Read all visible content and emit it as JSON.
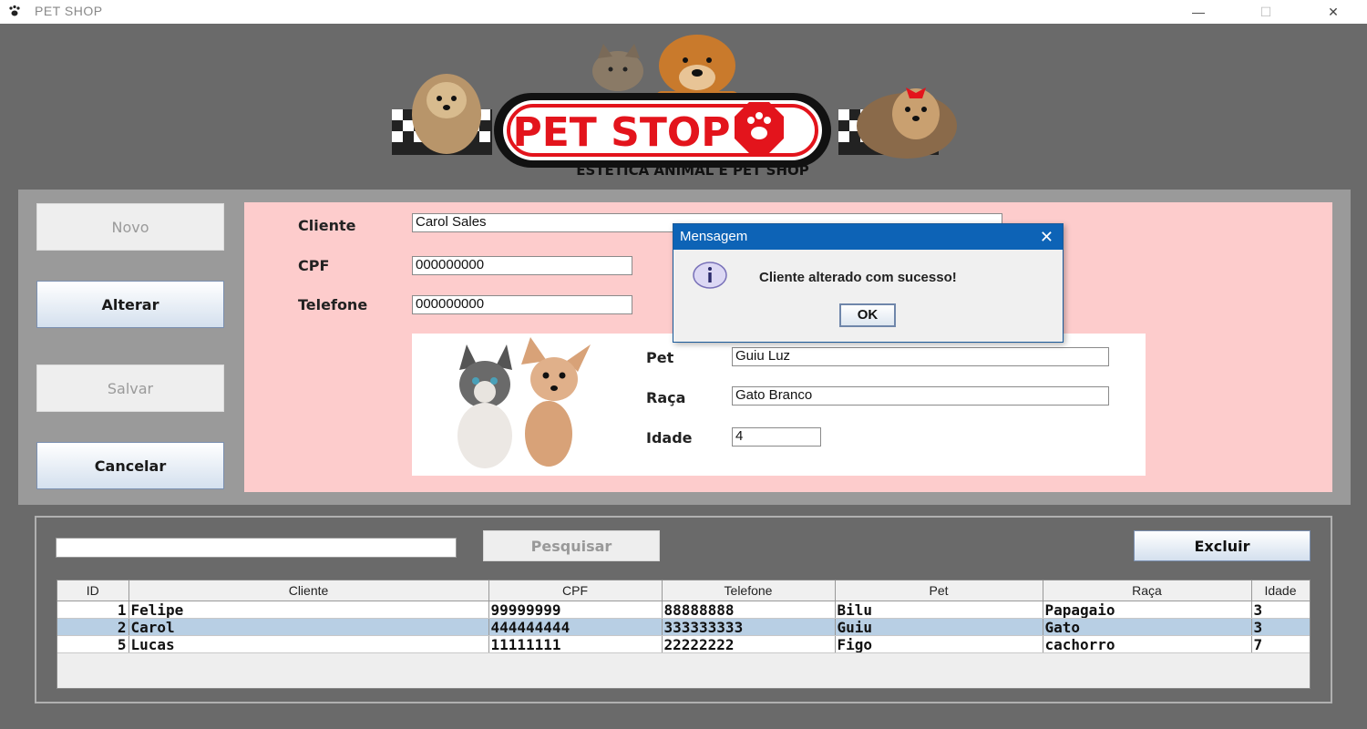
{
  "window": {
    "title": "PET SHOP",
    "minimize": "—",
    "maximize": "☐",
    "close": "✕"
  },
  "logo": {
    "brand": "PET STOP",
    "tagline": "ESTÉTICA ANIMAL E PET SHOP"
  },
  "buttons": {
    "novo": "Novo",
    "alterar": "Alterar",
    "salvar": "Salvar",
    "cancelar": "Cancelar",
    "pesquisar": "Pesquisar",
    "excluir": "Excluir"
  },
  "form": {
    "cliente_label": "Cliente",
    "cliente_value": "Carol Sales",
    "cpf_label": "CPF",
    "cpf_value": "000000000",
    "telefone_label": "Telefone",
    "telefone_value": "000000000",
    "pet_label": "Pet",
    "pet_value": "Guiu Luz",
    "raca_label": "Raça",
    "raca_value": "Gato Branco",
    "idade_label": "Idade",
    "idade_value": "4"
  },
  "search": {
    "value": ""
  },
  "table": {
    "headers": [
      "ID",
      "Cliente",
      "CPF",
      "Telefone",
      "Pet",
      "Raça",
      "Idade"
    ],
    "rows": [
      [
        "1",
        "Felipe",
        "99999999",
        "88888888",
        "Bilu",
        "Papagaio",
        "3"
      ],
      [
        "2",
        "Carol",
        "444444444",
        "333333333",
        "Guiu",
        "Gato",
        "3"
      ],
      [
        "5",
        "Lucas",
        "11111111",
        "22222222",
        "Figo",
        "cachorro",
        "7"
      ]
    ],
    "selected_row": 1
  },
  "dialog": {
    "title": "Mensagem",
    "message": "Cliente alterado com sucesso!",
    "ok": "OK",
    "close": "✕"
  },
  "colors": {
    "form_bg": "#fdcccc",
    "dialog_title": "#0d63b6",
    "selected_row": "#b8cfe4",
    "brand_red": "#e3141c"
  }
}
